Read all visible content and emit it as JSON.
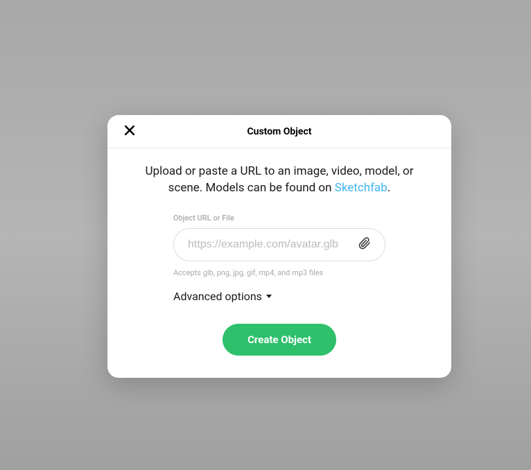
{
  "modal": {
    "title": "Custom Object",
    "description_prefix": "Upload or paste a URL to an image, video, model, or scene. Models can be found on ",
    "description_link": "Sketchfab",
    "description_suffix": ".",
    "field": {
      "label": "Object URL or File",
      "placeholder": "https://example.com/avatar.glb",
      "helper": "Accepts glb, png, jpg, gif, mp4, and mp3 files"
    },
    "advanced_label": "Advanced options",
    "submit_label": "Create Object"
  }
}
